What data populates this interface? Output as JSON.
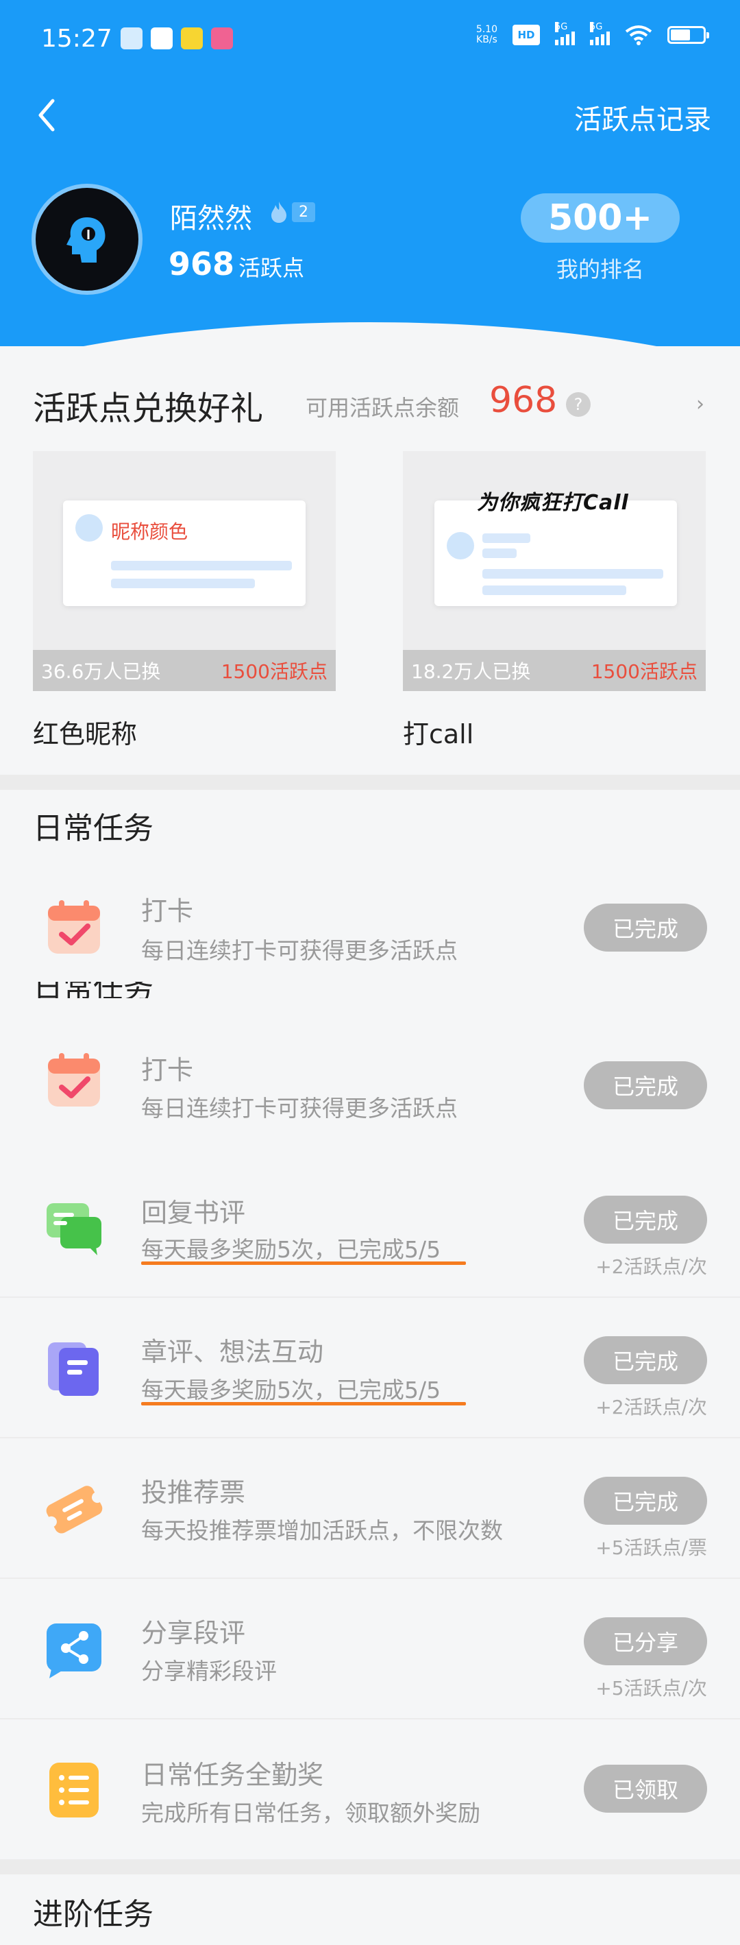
{
  "status_bar": {
    "time": "15:27",
    "net_speed_value": "5.10",
    "net_speed_unit": "KB/s",
    "hd_label": "HD",
    "signal1": "5G",
    "signal2": "5G"
  },
  "header": {
    "records_link": "活跃点记录",
    "username": "陌然然",
    "level": "2",
    "points": "968",
    "points_label": "活跃点",
    "rank": "500+",
    "rank_label": "我的排名"
  },
  "exchange": {
    "title": "活跃点兑换好礼",
    "balance_label": "可用活跃点余额",
    "balance": "968",
    "help": "?",
    "arrow": "›",
    "gifts": [
      {
        "name": "红色昵称",
        "preview_text": "昵称颜色",
        "count": "36.6万人已换",
        "cost": "1500活跃点"
      },
      {
        "name": "打call",
        "preview_text": "为你疯狂打Call",
        "count": "18.2万人已换",
        "cost": "1500活跃点"
      }
    ]
  },
  "daily": {
    "title": "日常任务",
    "tasks": [
      {
        "name": "打卡",
        "desc": "每日连续打卡可获得更多活跃点",
        "status": "已完成",
        "reward": "",
        "icon": "calendar-check-icon"
      },
      {
        "name": "打卡",
        "desc": "每日连续打卡可获得更多活跃点",
        "status": "已完成",
        "reward": "",
        "icon": "calendar-check-icon"
      },
      {
        "name": "回复书评",
        "desc": "每天最多奖励5次，已完成5/5",
        "status": "已完成",
        "reward": "+2活跃点/次",
        "icon": "chat-bubbles-icon"
      },
      {
        "name": "章评、想法互动",
        "desc": "每天最多奖励5次，已完成5/5",
        "status": "已完成",
        "reward": "+2活跃点/次",
        "icon": "note-stack-icon"
      },
      {
        "name": "投推荐票",
        "desc": "每天投推荐票增加活跃点，不限次数",
        "status": "已完成",
        "reward": "+5活跃点/票",
        "icon": "ticket-icon"
      },
      {
        "name": "分享段评",
        "desc": "分享精彩段评",
        "status": "已分享",
        "reward": "+5活跃点/次",
        "icon": "share-icon"
      },
      {
        "name": "日常任务全勤奖",
        "desc": "完成所有日常任务，领取额外奖励",
        "status": "已领取",
        "reward": "",
        "icon": "list-icon"
      }
    ]
  },
  "advanced": {
    "title": "进阶任务"
  },
  "colors": {
    "header_blue": "#1a9bf8",
    "accent_red": "#e94e3d",
    "underline_orange": "#f57b1f",
    "done_gray": "#b9b9b9"
  }
}
